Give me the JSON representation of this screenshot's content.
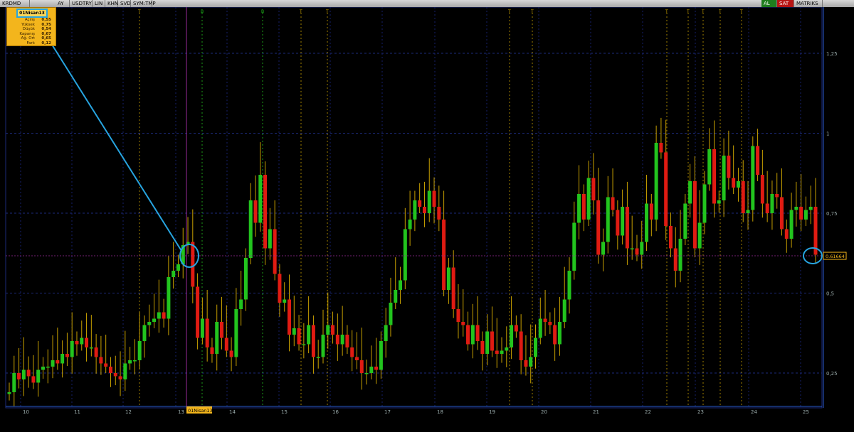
{
  "toolbar": {
    "symbol": "KRDMD",
    "items": [
      "AY",
      "USDTRY",
      "LIN",
      "KHN",
      "SVD",
      "SYM:TMP"
    ],
    "buy_label": "AL",
    "sell_label": "SAT",
    "matrix_label": "MATRIKS"
  },
  "info_box": {
    "date": "01Nisan13",
    "rows": [
      {
        "label": "Açılış",
        "value": "0,55"
      },
      {
        "label": "Yüksek",
        "value": "0,75"
      },
      {
        "label": "Düşük",
        "value": "0,54"
      },
      {
        "label": "Kapanış",
        "value": "0,67"
      },
      {
        "label": "Ağ. Ort",
        "value": "0,65"
      },
      {
        "label": "Fark",
        "value": "0,12"
      }
    ]
  },
  "colors": {
    "up": "#22c41e",
    "down": "#e01b12",
    "wick": "#c8a000",
    "callout": "#27a4e0",
    "crosshair": "#9a2a9a"
  },
  "chart_data": {
    "type": "candlestick",
    "symbol": "KRDMD",
    "period": "monthly",
    "x_tick_labels": [
      "10",
      "11",
      "12",
      "13",
      "01Nisan13",
      "14",
      "15",
      "16",
      "17",
      "18",
      "19",
      "20",
      "21",
      "22",
      "23",
      "24",
      "25"
    ],
    "y_ticks": [
      "0,25",
      "0,5",
      "0,75",
      "1",
      "1,25"
    ],
    "ylim": [
      0.02,
      1.52
    ],
    "current_price_label": "0.61664",
    "highlighted_period": "01Nisan13",
    "event_markers": [
      "T",
      "B",
      "B",
      "T",
      "T",
      "T",
      "T",
      "T",
      "T",
      "T",
      "T",
      "T"
    ],
    "closes_approx": [
      0.19,
      0.25,
      0.23,
      0.26,
      0.24,
      0.22,
      0.26,
      0.27,
      0.27,
      0.29,
      0.28,
      0.31,
      0.3,
      0.35,
      0.34,
      0.36,
      0.33,
      0.33,
      0.3,
      0.28,
      0.27,
      0.25,
      0.24,
      0.23,
      0.28,
      0.29,
      0.29,
      0.35,
      0.4,
      0.41,
      0.42,
      0.44,
      0.42,
      0.55,
      0.57,
      0.59,
      0.65,
      0.66,
      0.52,
      0.36,
      0.42,
      0.33,
      0.31,
      0.41,
      0.36,
      0.32,
      0.3,
      0.45,
      0.48,
      0.61,
      0.79,
      0.72,
      0.87,
      0.64,
      0.7,
      0.56,
      0.47,
      0.48,
      0.37,
      0.39,
      0.34,
      0.34,
      0.4,
      0.3,
      0.3,
      0.37,
      0.4,
      0.37,
      0.34,
      0.37,
      0.33,
      0.3,
      0.29,
      0.25,
      0.25,
      0.27,
      0.26,
      0.35,
      0.4,
      0.47,
      0.51,
      0.54,
      0.7,
      0.73,
      0.79,
      0.77,
      0.75,
      0.82,
      0.77,
      0.73,
      0.51,
      0.58,
      0.45,
      0.41,
      0.4,
      0.34,
      0.4,
      0.35,
      0.31,
      0.38,
      0.32,
      0.31,
      0.32,
      0.33,
      0.4,
      0.38,
      0.29,
      0.27,
      0.3,
      0.36,
      0.42,
      0.41,
      0.4,
      0.34,
      0.41,
      0.48,
      0.57,
      0.72,
      0.81,
      0.73,
      0.86,
      0.79,
      0.62,
      0.66,
      0.8,
      0.76,
      0.68,
      0.77,
      0.64,
      0.64,
      0.62,
      0.66,
      0.78,
      0.73,
      0.97,
      0.94,
      0.71,
      0.64,
      0.57,
      0.67,
      0.78,
      0.85,
      0.64,
      0.72,
      0.84,
      0.95,
      0.78,
      0.79,
      0.93,
      0.86,
      0.83,
      0.85,
      0.75,
      0.76,
      0.96,
      0.87,
      0.78,
      0.75,
      0.81,
      0.8,
      0.7,
      0.67,
      0.76,
      0.77,
      0.73,
      0.76,
      0.77,
      0.62
    ]
  }
}
